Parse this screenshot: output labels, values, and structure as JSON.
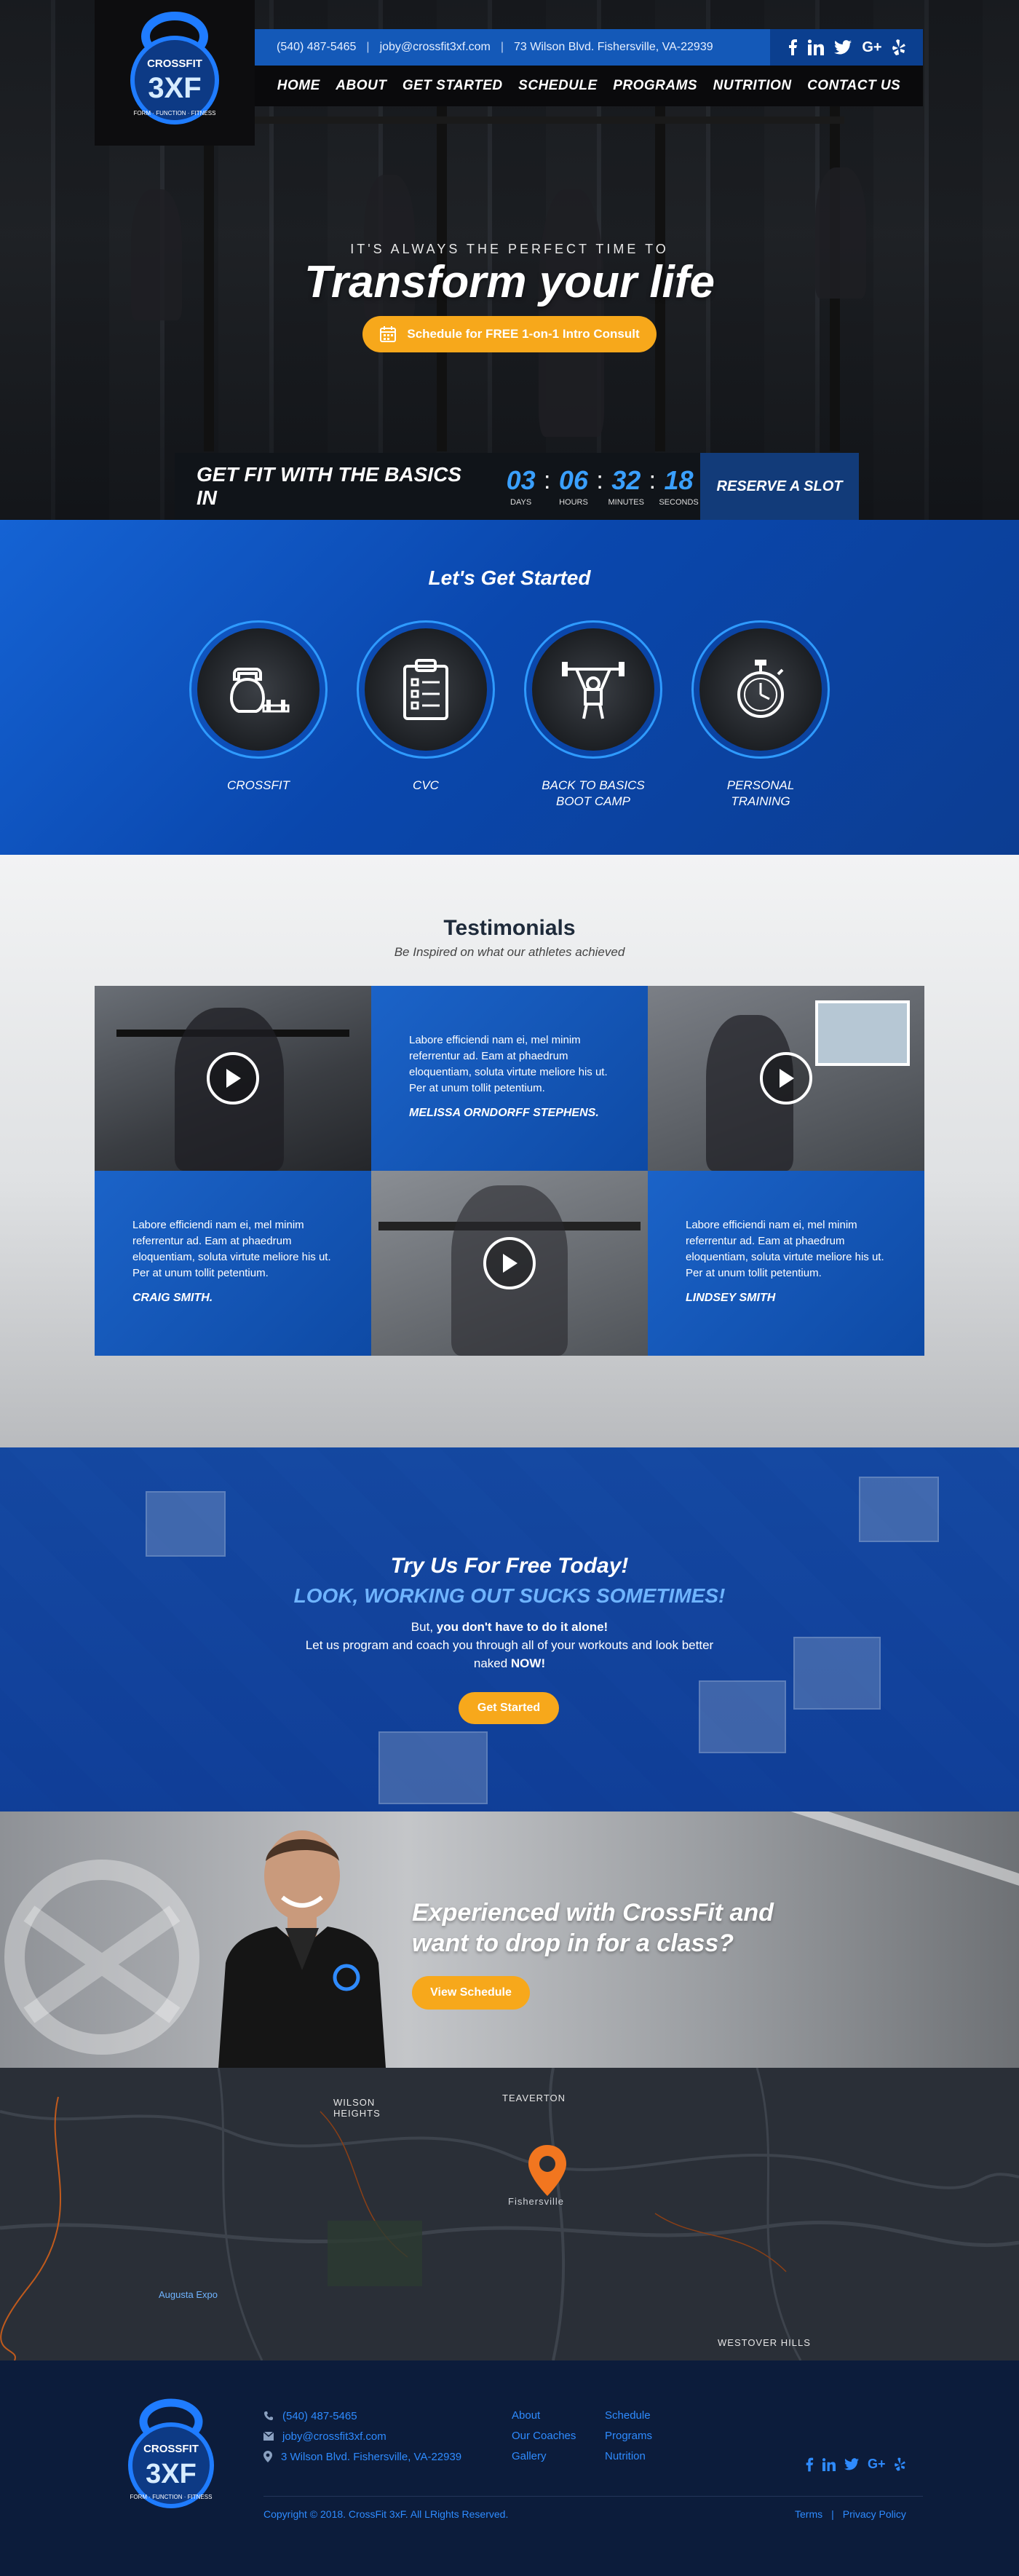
{
  "brand": {
    "name": "CROSSFIT",
    "mark": "3XF",
    "tagline": "FORM · FUNCTION · FITNESS",
    "colors": {
      "primary": "#1459b8",
      "accent": "#f7a81b",
      "dark": "#0a0a0c",
      "footer": "#0c1c3b",
      "link": "#2e8bff"
    }
  },
  "topbar": {
    "phone": "(540) 487-5465",
    "email": "joby@crossfit3xf.com",
    "address": "73 Wilson Blvd. Fishersville, VA-22939",
    "social": [
      "facebook-icon",
      "linkedin-icon",
      "twitter-icon",
      "google-plus-icon",
      "yelp-icon"
    ]
  },
  "nav": {
    "items": [
      {
        "label": "HOME"
      },
      {
        "label": "ABOUT"
      },
      {
        "label": "GET STARTED"
      },
      {
        "label": "SCHEDULE"
      },
      {
        "label": "PROGRAMS"
      },
      {
        "label": "NUTRITION"
      },
      {
        "label": "CONTACT US"
      }
    ]
  },
  "hero": {
    "kicker": "IT'S ALWAYS THE PERFECT TIME TO",
    "title": "Transform your life",
    "cta_label": "Schedule for FREE 1-on-1 Intro Consult",
    "cta_icon": "calendar-icon"
  },
  "countdown": {
    "label": "GET FIT WITH THE BASICS IN",
    "units": [
      {
        "value": "03",
        "caption": "DAYS"
      },
      {
        "value": "06",
        "caption": "HOURS"
      },
      {
        "value": "32",
        "caption": "MINUTES"
      },
      {
        "value": "18",
        "caption": "SECONDS"
      }
    ],
    "reserve_label": "RESERVE A  SLOT"
  },
  "started": {
    "title": "Let's Get Started",
    "programs": [
      {
        "label": "CROSSFIT",
        "icon": "kettlebell-icon"
      },
      {
        "label": "CVC",
        "icon": "clipboard-icon"
      },
      {
        "label": "BACK TO BASICS\nBOOT CAMP",
        "line1": "BACK TO BASICS",
        "line2": "BOOT CAMP",
        "icon": "weightlifter-icon"
      },
      {
        "label": "PERSONAL\nTRAINING",
        "line1": "PERSONAL",
        "line2": "TRAINING",
        "icon": "stopwatch-icon"
      }
    ]
  },
  "testimonials": {
    "title": "Testimonials",
    "subtitle": "Be Inspired on what our athletes achieved",
    "quotes": [
      {
        "text": "Labore efficiendi nam ei, mel minim referrentur ad. Eam at phaedrum eloquentiam, soluta virtute meliore his ut. Per at unum tollit petentium.",
        "name": "MELISSA ORNDORFF STEPHENS."
      },
      {
        "text": "Labore efficiendi nam ei, mel minim referrentur ad. Eam at phaedrum eloquentiam, soluta virtute meliore his ut. Per at unum tollit petentium.",
        "name": "CRAIG SMITH."
      },
      {
        "text": "Labore efficiendi nam ei, mel minim referrentur ad. Eam at phaedrum eloquentiam, soluta virtute meliore his ut. Per at unum tollit petentium.",
        "name": "LINDSEY SMITH"
      }
    ]
  },
  "tryfree": {
    "title": "Try Us For Free Today!",
    "subtitle": "LOOK, WORKING OUT SUCKS SOMETIMES!",
    "line1_pre": "But, ",
    "line1_bold": "you don't have to do it alone!",
    "line2_pre": "Let us program and coach you through all of your workouts and look better naked ",
    "line2_bold": "NOW!",
    "cta_label": "Get Started"
  },
  "experienced": {
    "title_line1": "Experienced with CrossFit and",
    "title_line2": "want to drop in for a class?",
    "cta_label": "View Schedule"
  },
  "map": {
    "labels": {
      "wilson_heights_1": "WILSON",
      "wilson_heights_2": "HEIGHTS",
      "teaverton": "TEAVERTON",
      "fishersville": "Fishersville",
      "augusta_expo": "Augusta Expo",
      "westover_hills": "WESTOVER HILLS"
    },
    "pin_icon": "map-pin-icon"
  },
  "footer": {
    "contact": {
      "phone": "(540) 487-5465",
      "email": "joby@crossfit3xf.com",
      "address": "3 Wilson Blvd. Fishersville, VA-22939"
    },
    "links_col1": [
      "About",
      "Our Coaches",
      "Gallery"
    ],
    "links_col2": [
      "Schedule",
      "Programs",
      "Nutrition"
    ],
    "copyright": "Copyright © 2018. CrossFit 3xF. All LRights Reserved.",
    "terms": "Terms",
    "divider": "|",
    "privacy": "Privacy Policy"
  }
}
